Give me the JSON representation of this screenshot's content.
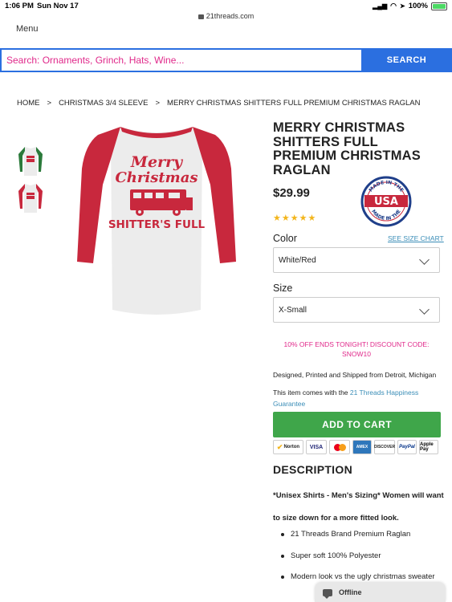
{
  "status_bar": {
    "time": "1:06 PM",
    "date": "Sun Nov 17",
    "url": "21threads.com",
    "battery": "100%",
    "battery_level": 1.0
  },
  "nav": {
    "menu_label": "Menu"
  },
  "search": {
    "placeholder": "Search: Ornaments, Grinch, Hats, Wine...",
    "button_label": "SEARCH"
  },
  "breadcrumb": [
    "HOME",
    "CHRISTMAS 3/4 SLEEVE",
    "MERRY CHRISTMAS SHITTERS FULL PREMIUM CHRISTMAS RAGLAN"
  ],
  "breadcrumb_sep": ">",
  "product": {
    "title": "MERRY CHRISTMAS SHITTERS FULL PREMIUM CHRISTMAS RAGLAN",
    "price": "$29.99",
    "rating": 5,
    "badge_text": {
      "top": "MADE IN THE",
      "center": "USA",
      "bottom": "MADE IN THE"
    },
    "shirt_text": {
      "line1": "Merry",
      "line2": "Christmas",
      "line3": "SHITTER'S FULL"
    },
    "colors": {
      "sleeve_red": "#c8283d",
      "body_white": "#ececec",
      "green": "#2a7a3a",
      "star": "#f3b51b"
    }
  },
  "options": {
    "color_label": "Color",
    "size_chart_link": "SEE SIZE CHART",
    "color_value": "White/Red",
    "size_label": "Size",
    "size_value": "X-Small"
  },
  "promo": "10% OFF ENDS TONIGHT! DISCOUNT CODE: SNOW10",
  "made_in": "Designed, Printed and Shipped from Detroit, Michigan",
  "guarantee": {
    "prefix": "This item comes with the ",
    "link": "21 Threads Happiness Guarantee"
  },
  "add_to_cart": "ADD TO CART",
  "payment_badges": [
    "Norton",
    "VISA",
    "MasterCard",
    "AMEX",
    "DISCOVER",
    "PayPal",
    "Apple Pay"
  ],
  "description": {
    "heading": "DESCRIPTION",
    "intro": "*Unisex Shirts - Men's Sizing*  Women will want to size down for a more fitted look.",
    "bullets": [
      "21 Threads Brand Premium Raglan",
      "Super soft 100% Polyester",
      "Modern look vs the ugly christmas sweater"
    ]
  },
  "chat": {
    "label": "Offline"
  }
}
